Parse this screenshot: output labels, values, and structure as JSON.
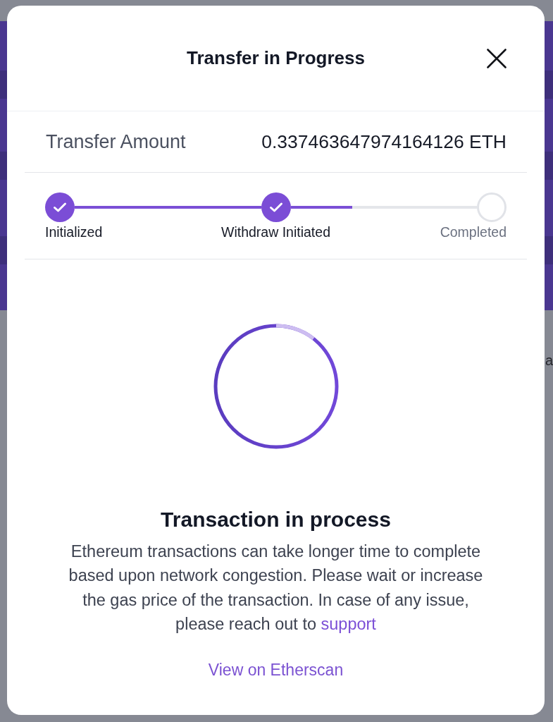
{
  "background_page": {
    "text": "a"
  },
  "dialog": {
    "title": "Transfer in Progress"
  },
  "transfer": {
    "label": "Transfer Amount",
    "value": "0.337463647974164126 ETH"
  },
  "stepper": {
    "steps": [
      {
        "label": "Initialized",
        "completed": true
      },
      {
        "label": "Withdraw Initiated",
        "completed": true
      },
      {
        "label": "Completed",
        "completed": false
      }
    ],
    "active_connector": {
      "level": 0.33
    }
  },
  "status": {
    "title": "Transaction in process",
    "text": "Ethereum transactions can take longer time to complete based upon network congestion. Please wait or increase the gas price of the transaction. In case of any issue, please reach out to",
    "link": "support"
  },
  "action_link": "View on Etherscan"
}
